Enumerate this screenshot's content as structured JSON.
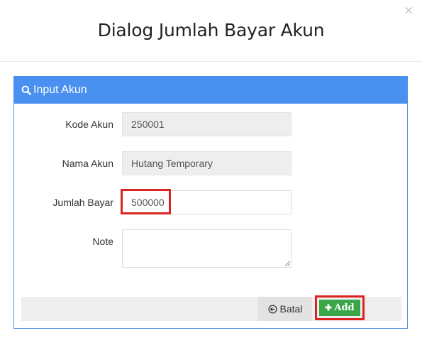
{
  "dialog": {
    "title": "Dialog Jumlah Bayar Akun",
    "close_glyph": "×"
  },
  "panel": {
    "title": "Input Akun",
    "icon": "search-icon",
    "accent_color": "#4a90f0"
  },
  "form": {
    "kode_akun": {
      "label": "Kode Akun",
      "value": "250001"
    },
    "nama_akun": {
      "label": "Nama Akun",
      "value": "Hutang Temporary"
    },
    "jumlah_bayar": {
      "label": "Jumlah Bayar",
      "value": "500000"
    },
    "note": {
      "label": "Note",
      "value": ""
    }
  },
  "buttons": {
    "cancel_label": "Batal",
    "cancel_icon": "back-circle-icon",
    "add_label": "Add",
    "add_icon": "plus-icon",
    "add_color": "#3aa64a",
    "highlight_color": "#d9251d"
  }
}
